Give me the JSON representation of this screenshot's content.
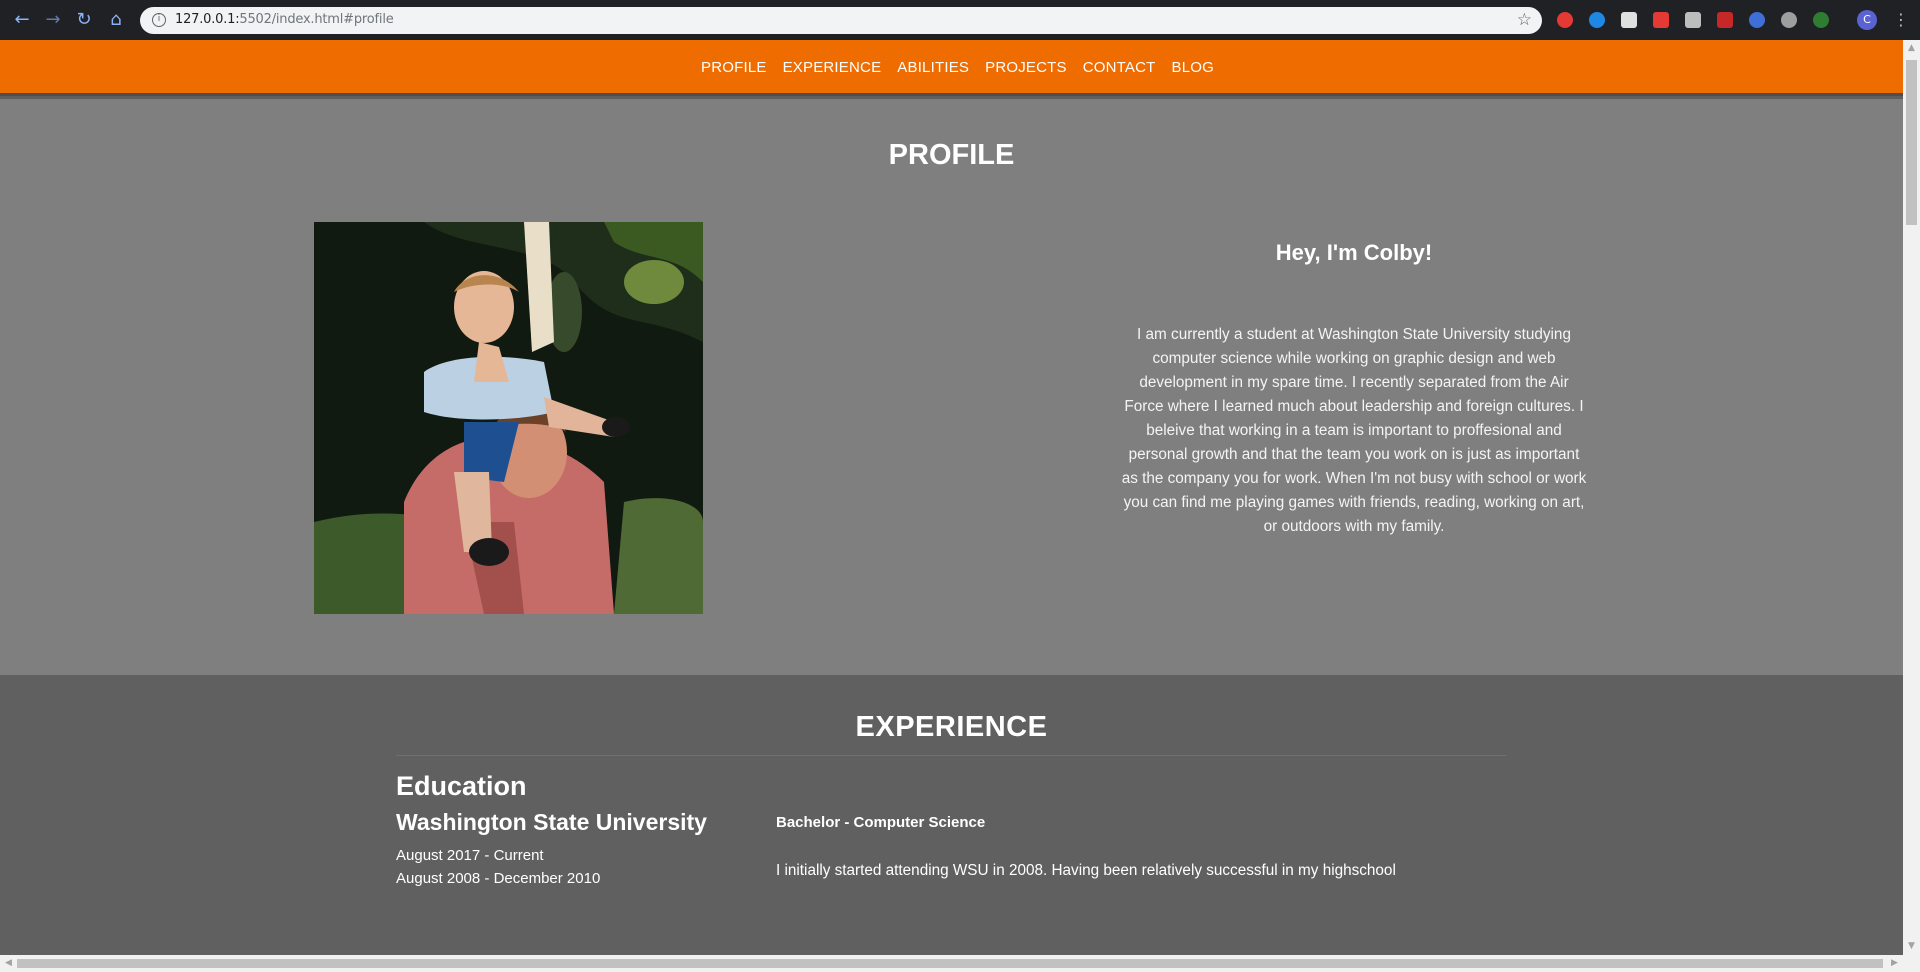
{
  "browser": {
    "url_host": "127.0.0.1:",
    "url_rest": "5502/index.html#profile",
    "back_icon": "←",
    "forward_icon": "→",
    "reload_icon": "↻",
    "home_icon": "⌂",
    "info_icon": "i",
    "star_icon": "☆",
    "avatar_letter": "C",
    "menu_icon": "⋮"
  },
  "nav": {
    "items": [
      "PROFILE",
      "EXPERIENCE",
      "ABILITIES",
      "PROJECTS",
      "CONTACT",
      "BLOG"
    ],
    "color": "#ef6c00"
  },
  "profile": {
    "title": "PROFILE",
    "greeting": "Hey, I'm Colby!",
    "bio": "I am currently a student at Washington State University studying computer science while working on graphic design and web development in my spare time. I recently separated from the Air Force where I learned much about leadership and foreign cultures. I beleive that working in a team is important to proffesional and personal growth and that the team you work on is just as important as the company you for work. When I'm not busy with school or work you can find me playing games with friends, reading, working on art, or outdoors with my family."
  },
  "experience": {
    "title": "EXPERIENCE",
    "education_heading": "Education",
    "school": "Washington State University",
    "dates_1": "August 2017 - Current",
    "dates_2": "August 2008 - December 2010",
    "degree": "Bachelor - Computer Science",
    "text": "I initially started attending WSU in 2008. Having been relatively successful in my highschool"
  }
}
